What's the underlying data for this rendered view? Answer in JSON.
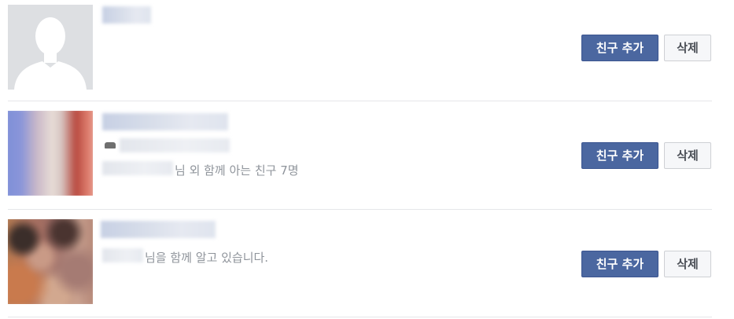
{
  "requests": [
    {
      "mutual_text": "",
      "add_label": "친구 추가",
      "delete_label": "삭제"
    },
    {
      "mutual_text": "님 외 함께 아는 친구 7명",
      "add_label": "친구 추가",
      "delete_label": "삭제"
    },
    {
      "mutual_text": "님을 함께 알고 있습니다.",
      "add_label": "친구 추가",
      "delete_label": "삭제"
    }
  ],
  "colors": {
    "add_button": "#4b67a0",
    "delete_button": "#f6f7f9",
    "divider": "#e5e6e9",
    "mutual_text": "#8f949b"
  }
}
